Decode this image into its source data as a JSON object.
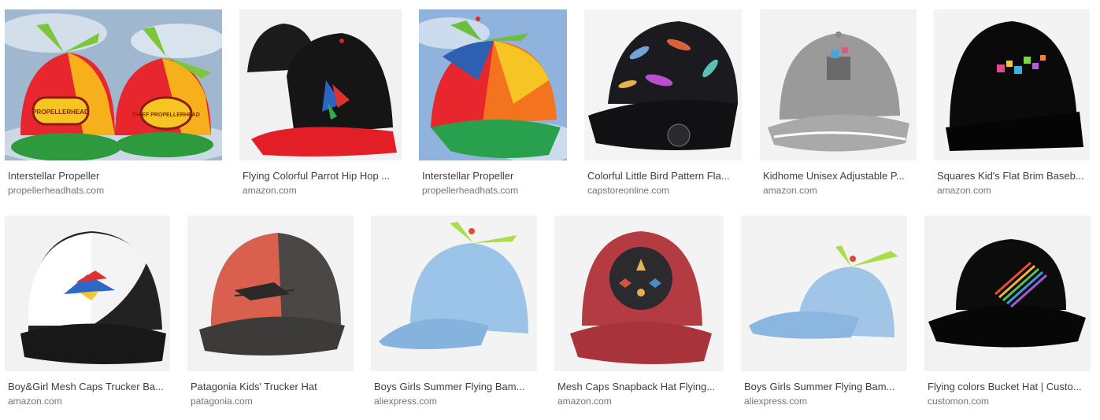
{
  "results": [
    {
      "title": "Interstellar Propeller",
      "source": "propellerheadhats.com",
      "image": "propeller-beanie-pair-image",
      "colors": {
        "bg": "#9fb7cf"
      },
      "badges": [
        "PROPELLERHEAD",
        "CHIEF PROPELLERHEAD"
      ]
    },
    {
      "title": "Flying Colorful Parrot Hip Hop ...",
      "source": "amazon.com",
      "image": "parrot-snapback-image",
      "colors": {
        "bg": "#f1f1f1"
      }
    },
    {
      "title": "Interstellar Propeller",
      "source": "propellerheadhats.com",
      "image": "propeller-beanie-image",
      "colors": {
        "bg": "#8fb3dc"
      }
    },
    {
      "title": "Colorful Little Bird Pattern Fla...",
      "source": "capstoreonline.com",
      "image": "bird-pattern-cap-image",
      "colors": {
        "bg": "#f4f4f4"
      }
    },
    {
      "title": "Kidhome Unisex Adjustable P...",
      "source": "amazon.com",
      "image": "grey-baseball-cap-image",
      "colors": {
        "bg": "#f2f2f2"
      }
    },
    {
      "title": "Squares Kid's Flat Brim Baseb...",
      "source": "amazon.com",
      "image": "black-flat-brim-cap-image",
      "colors": {
        "bg": "#f3f3f3"
      }
    },
    {
      "title": "Boy&Girl Mesh Caps Trucker Ba...",
      "source": "amazon.com",
      "image": "parrot-trucker-cap-image",
      "colors": {
        "bg": "#f2f2f2"
      }
    },
    {
      "title": "Patagonia Kids' Trucker Hat",
      "source": "patagonia.com",
      "image": "patagonia-trucker-hat-image",
      "colors": {
        "bg": "#f2f2f2"
      }
    },
    {
      "title": "Boys Girls Summer Flying Bam...",
      "source": "aliexpress.com",
      "image": "blue-propeller-cap-image",
      "colors": {
        "bg": "#f3f3f3"
      }
    },
    {
      "title": "Mesh Caps Snapback Hat Flying...",
      "source": "amazon.com",
      "image": "red-washed-cap-image",
      "colors": {
        "bg": "#f3f3f3"
      }
    },
    {
      "title": "Boys Girls Summer Flying Bam...",
      "source": "aliexpress.com",
      "image": "blue-propeller-cap-side-image",
      "colors": {
        "bg": "#f3f3f3"
      }
    },
    {
      "title": "Flying colors Bucket Hat | Custo...",
      "source": "customon.com",
      "image": "black-bucket-hat-image",
      "colors": {
        "bg": "#f2f2f2"
      }
    }
  ]
}
